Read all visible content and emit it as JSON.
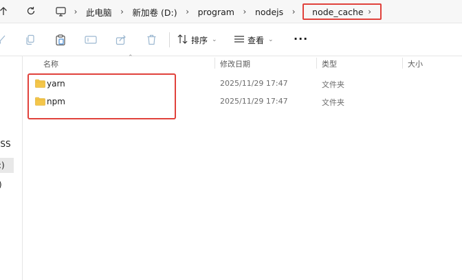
{
  "address_bar": {
    "breadcrumbs": [
      "此电脑",
      "新加卷 (D:)",
      "program",
      "nodejs"
    ],
    "current": "node_cache"
  },
  "toolbar": {
    "sort_label": "排序",
    "view_label": "查看",
    "more_label": "···"
  },
  "left_nav": {
    "fragments": [
      "-SS",
      ":)",
      ")"
    ]
  },
  "columns": {
    "name": "名称",
    "modified": "修改日期",
    "type": "类型",
    "size": "大小"
  },
  "files": [
    {
      "name": "yarn",
      "modified": "2025/11/29 17:47",
      "type": "文件夹",
      "icon": "folder-icon"
    },
    {
      "name": "npm",
      "modified": "2025/11/29 17:47",
      "type": "文件夹",
      "icon": "folder-icon"
    }
  ],
  "colors": {
    "highlight": "#e0403a",
    "folder": "#f4c64a"
  }
}
